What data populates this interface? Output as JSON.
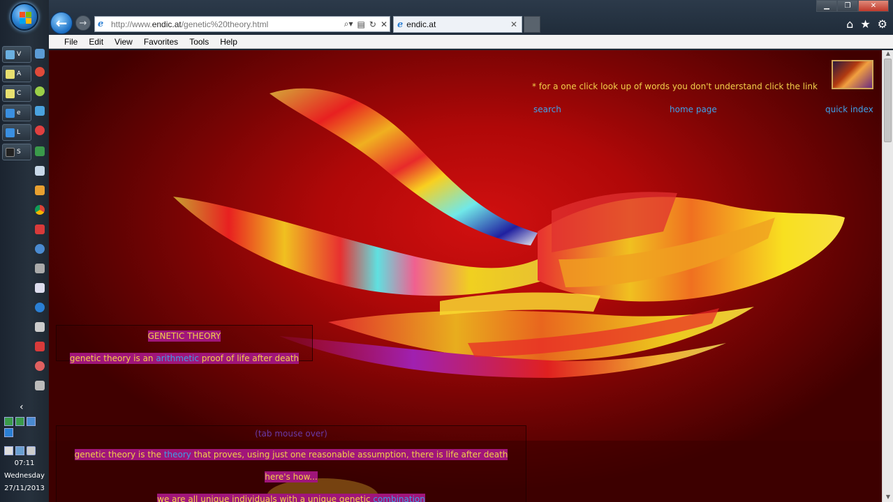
{
  "taskbar": {
    "task_buttons": [
      {
        "label": "V"
      },
      {
        "label": "A"
      },
      {
        "label": "C"
      },
      {
        "label": "e"
      },
      {
        "label": "L"
      },
      {
        "label": "S"
      }
    ],
    "clock": {
      "time": "07:11",
      "day": "Wednesday",
      "date": "27/11/2013"
    },
    "chevron": "‹"
  },
  "browser": {
    "address_prefix": "http://www.",
    "address_domain": "endic.at",
    "address_path": "/genetic%20theory.html",
    "tab_title": "endic.at",
    "menu": [
      "File",
      "Edit",
      "View",
      "Favorites",
      "Tools",
      "Help"
    ]
  },
  "page": {
    "lookup_note": "* for a one click look up of words you don't understand click the link",
    "nav": {
      "search": "search",
      "home": "home page",
      "index": "quick index"
    },
    "box1": {
      "heading": "GENETIC THEORY",
      "line_before": "genetic theory is an ",
      "line_link": "arithmetic",
      "line_after": " proof of life after death"
    },
    "box2": {
      "faded_heading": "(tab mouse over)",
      "line1_before": "genetic theory is the ",
      "line1_link": "theory",
      "line1_after": " that proves, using just one reasonable assumption, there is life after death",
      "line2": "here's how...",
      "line3_before": "we are all unique individuals with a unique genetic ",
      "line3_link": "combination"
    }
  },
  "colors": {
    "page_text": "#f2d04a",
    "link": "#3fa2ea",
    "highlight": "#a0157a",
    "background": "#b00808"
  }
}
